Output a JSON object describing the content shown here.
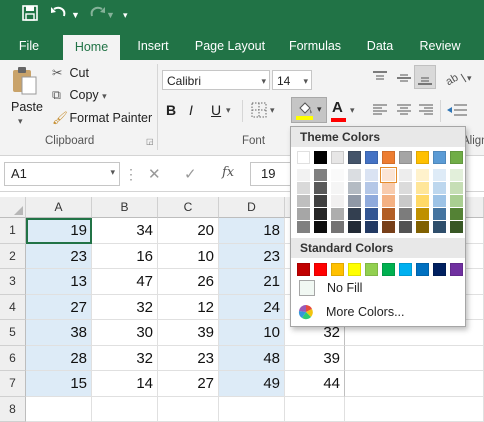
{
  "quick_access": {
    "save_icon": "save-icon",
    "undo_icon": "undo-icon",
    "redo_icon": "redo-icon",
    "customize_icon": "chevron-down-icon"
  },
  "tabs": [
    "File",
    "Home",
    "Insert",
    "Page Layout",
    "Formulas",
    "Data",
    "Review"
  ],
  "active_tab": "Home",
  "clipboard": {
    "paste": "Paste",
    "cut": "Cut",
    "copy": "Copy",
    "format_painter": "Format Painter",
    "group_label": "Clipboard"
  },
  "font": {
    "name": "Calibri",
    "size": "14",
    "bold": "B",
    "italic": "I",
    "underline": "U",
    "group_label": "Font",
    "font_color_letter": "A"
  },
  "alignment": {
    "group_label": "Align"
  },
  "formula_bar": {
    "name_box": "A1",
    "fx": "fx",
    "value": "19"
  },
  "columns": [
    "A",
    "B",
    "C",
    "D"
  ],
  "rows": [
    {
      "num": "1",
      "cells": [
        "19",
        "34",
        "20",
        "18"
      ]
    },
    {
      "num": "2",
      "cells": [
        "23",
        "16",
        "10",
        "23"
      ]
    },
    {
      "num": "3",
      "cells": [
        "13",
        "47",
        "26",
        "21"
      ]
    },
    {
      "num": "4",
      "cells": [
        "27",
        "32",
        "12",
        "24"
      ]
    },
    {
      "num": "5",
      "cells": [
        "38",
        "30",
        "39",
        "10",
        "32"
      ]
    },
    {
      "num": "6",
      "cells": [
        "28",
        "32",
        "23",
        "48",
        "39"
      ]
    },
    {
      "num": "7",
      "cells": [
        "15",
        "14",
        "27",
        "49",
        "44"
      ]
    },
    {
      "num": "8",
      "cells": []
    }
  ],
  "fill_menu": {
    "theme_header": "Theme Colors",
    "standard_header": "Standard Colors",
    "no_fill": "No Fill",
    "more_colors": "More Colors...",
    "theme_colors": [
      "#ffffff",
      "#000000",
      "#e7e6e6",
      "#44546a",
      "#4472c4",
      "#ed7d31",
      "#a5a5a5",
      "#ffc000",
      "#5b9bd5",
      "#70ad47"
    ],
    "standard_colors": [
      "#c00000",
      "#ff0000",
      "#ffc000",
      "#ffff00",
      "#92d050",
      "#00b050",
      "#00b0f0",
      "#0070c0",
      "#002060",
      "#7030a0"
    ]
  }
}
